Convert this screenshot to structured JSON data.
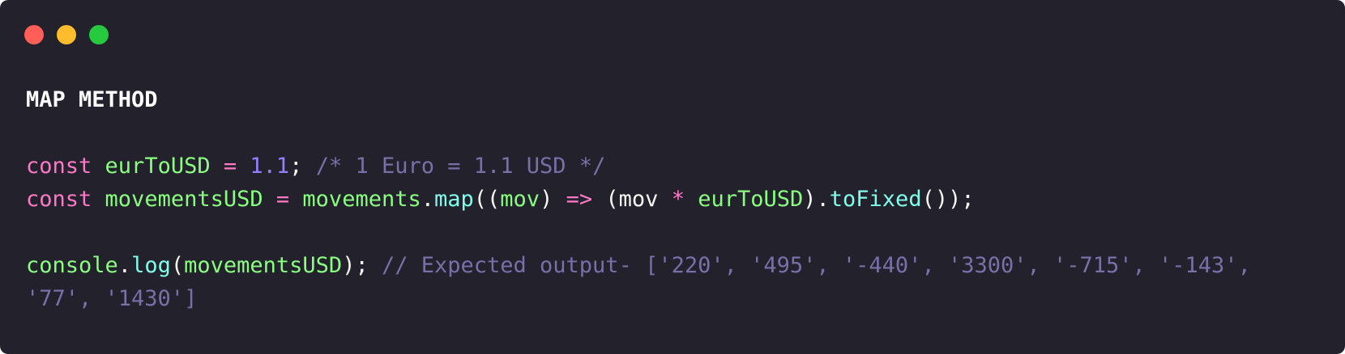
{
  "window": {
    "controls": {
      "close_color": "#ff5f56",
      "minimize_color": "#ffbd2e",
      "maximize_color": "#27c93f"
    },
    "background": "#22212c"
  },
  "code": {
    "heading": "MAP METHOD",
    "line1": {
      "kw": "const",
      "name": "eurToUSD",
      "eq": "=",
      "value": "1.1",
      "semi": ";",
      "comment": "/* 1 Euro = 1.1 USD */"
    },
    "line2": {
      "kw": "const",
      "name": "movementsUSD",
      "eq": "=",
      "obj": "movements",
      "dot": ".",
      "method": "map",
      "open": "((",
      "param": "mov",
      "close_param": ")",
      "arrow": "=>",
      "paren_open": "(mov",
      "mul": "*",
      "ref": "eurToUSD",
      "paren_close": ").",
      "method2": "toFixed",
      "end": "());"
    },
    "line3": {
      "obj": "console",
      "dot": ".",
      "method": "log",
      "open": "(",
      "arg": "movementsUSD",
      "close": ");",
      "comment": "// Expected output- ['220', '495', '-440', '3300', '-715', '-143',"
    },
    "line4": {
      "comment": "'77', '1430']"
    }
  },
  "colors": {
    "keyword": "#ff79c6",
    "variable": "#8aff80",
    "number": "#9580ff",
    "function": "#80ffea",
    "comment": "#7970a9"
  }
}
